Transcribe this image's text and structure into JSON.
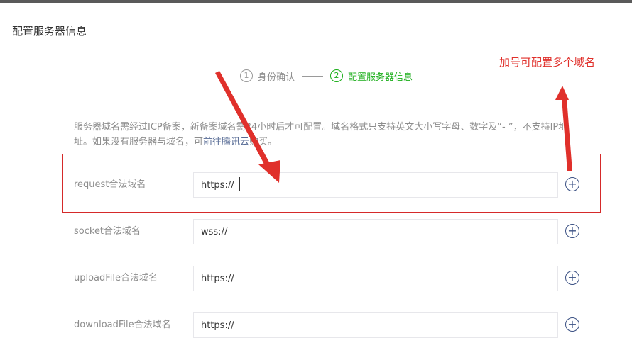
{
  "page": {
    "title": "配置服务器信息"
  },
  "steps": [
    {
      "number": "1",
      "label": "身份确认",
      "active": false
    },
    {
      "number": "2",
      "label": "配置服务器信息",
      "active": true
    }
  ],
  "annotation": {
    "text": "加号可配置多个域名"
  },
  "description": {
    "text_before": "服务器域名需经过ICP备案，新备案域名需24小时后才可配置。域名格式只支持英文大小写字母、数字及“- ”，不支持IP地址。如果没有服务器与域名，可",
    "link": "前往腾讯云",
    "text_after": "购买。"
  },
  "fields": [
    {
      "label": "request合法域名",
      "value": "https://",
      "add_symbol": "+"
    },
    {
      "label": "socket合法域名",
      "value": "wss://",
      "add_symbol": "+"
    },
    {
      "label": "uploadFile合法域名",
      "value": "https://",
      "add_symbol": "+"
    },
    {
      "label": "downloadFile合法域名",
      "value": "https://",
      "add_symbol": "+"
    }
  ],
  "colors": {
    "accent_green": "#1aad19",
    "annotation_red": "#e0302b",
    "link_blue": "#576b95"
  }
}
